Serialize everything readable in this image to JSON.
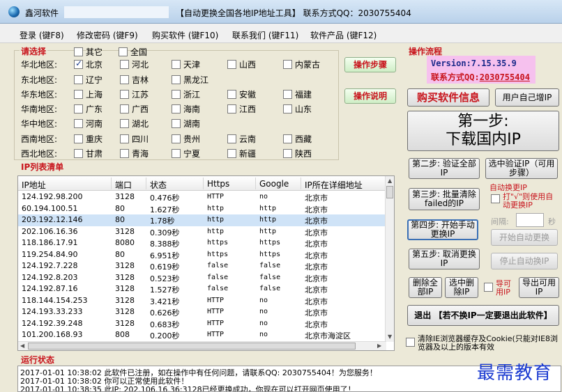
{
  "titlebar": {
    "app_name": "鑫河软件",
    "title": "【自动更换全国各地IP地址工具】 联系方式QQ：2030755404"
  },
  "menu": [
    "登录 (键F8)",
    "修改密码 (键F9)",
    "购买软件 (键F10)",
    "联系我们 (键F11)",
    "软件产品 (键F12)"
  ],
  "region_select": {
    "title": "请选择",
    "top_options": [
      {
        "label": "其它",
        "checked": false
      },
      {
        "label": "全国",
        "checked": false
      }
    ],
    "rows": [
      {
        "label": "华北地区:",
        "items": [
          {
            "label": "北京",
            "checked": true
          },
          {
            "label": "河北",
            "checked": false
          },
          {
            "label": "天津",
            "checked": false
          },
          {
            "label": "山西",
            "checked": false
          },
          {
            "label": "内蒙古",
            "checked": false
          }
        ]
      },
      {
        "label": "东北地区:",
        "items": [
          {
            "label": "辽宁",
            "checked": false
          },
          {
            "label": "吉林",
            "checked": false
          },
          {
            "label": "黑龙江",
            "checked": false
          }
        ]
      },
      {
        "label": "华东地区:",
        "items": [
          {
            "label": "上海",
            "checked": false
          },
          {
            "label": "江苏",
            "checked": false
          },
          {
            "label": "浙江",
            "checked": false
          },
          {
            "label": "安徽",
            "checked": false
          },
          {
            "label": "福建",
            "checked": false
          }
        ]
      },
      {
        "label": "华南地区:",
        "items": [
          {
            "label": "广东",
            "checked": false
          },
          {
            "label": "广西",
            "checked": false
          },
          {
            "label": "海南",
            "checked": false
          },
          {
            "label": "江西",
            "checked": false
          },
          {
            "label": "山东",
            "checked": false
          }
        ]
      },
      {
        "label": "华中地区:",
        "items": [
          {
            "label": "河南",
            "checked": false
          },
          {
            "label": "湖北",
            "checked": false
          },
          {
            "label": "湖南",
            "checked": false
          }
        ]
      },
      {
        "label": "西南地区:",
        "items": [
          {
            "label": "重庆",
            "checked": false
          },
          {
            "label": "四川",
            "checked": false
          },
          {
            "label": "贵州",
            "checked": false
          },
          {
            "label": "云南",
            "checked": false
          },
          {
            "label": "西藏",
            "checked": false
          }
        ]
      },
      {
        "label": "西北地区:",
        "items": [
          {
            "label": "甘肃",
            "checked": false
          },
          {
            "label": "青海",
            "checked": false
          },
          {
            "label": "宁夏",
            "checked": false
          },
          {
            "label": "新疆",
            "checked": false
          },
          {
            "label": "陕西",
            "checked": false
          }
        ]
      }
    ],
    "steps_button": "操作步骤",
    "help_button": "操作说明"
  },
  "process": {
    "title": "操作流程",
    "version": "Version:7.15.35.9",
    "contact_label": "联系方式QQ:",
    "contact_qq": "2030755404",
    "buy_button": "购买软件信息",
    "add_ip_button": "用户自己增IP",
    "step1_line1": "第一步:",
    "step1_line2": "下载国内IP",
    "step2_button": "第二步: 验证全部IP",
    "verify_ip_button": "选中验证IP（可用步骤）",
    "auto_title": "自动换更IP",
    "step3_button": "第三步: 批量清除failed的IP",
    "auto_hint": "打\"√\"则使用自动更换IP",
    "interval_label": "间隔:",
    "interval_unit": "秒",
    "step4_button": "第四步: 开始手动更换IP",
    "start_auto_button": "开始自动更换",
    "step5_button": "第五步: 取消更换IP",
    "stop_auto_button": "停止自动换IP",
    "delete_all_button": "删除全部IP",
    "delete_selected_button": "选中删除IP",
    "exportable_label": "导可用IP",
    "export_button": "导出可用IP",
    "exit_button": "退出 【若不换IP一定要退出此软件】",
    "clear_cookie_label": "清除IE浏览器缓存及Cookie(只能对IE8浏览器及以上的版本有效"
  },
  "ip_list": {
    "title": "IP列表清单",
    "columns": [
      "IP地址",
      "端口",
      "状态",
      "Https",
      "Google",
      "IP所在详细地址"
    ],
    "rows": [
      [
        "124.192.98.200",
        "3128",
        "0.476秒",
        "HTTP",
        "no",
        "北京市"
      ],
      [
        "60.194.100.51",
        "80",
        "1.627秒",
        "http",
        "http",
        "北京市"
      ],
      [
        "203.192.12.146",
        "80",
        "1.78秒",
        "http",
        "http",
        "北京市"
      ],
      [
        "202.106.16.36",
        "3128",
        "0.309秒",
        "http",
        "http",
        "北京市"
      ],
      [
        "118.186.17.91",
        "8080",
        "8.388秒",
        "https",
        "https",
        "北京市"
      ],
      [
        "119.254.84.90",
        "80",
        "6.951秒",
        "https",
        "https",
        "北京市"
      ],
      [
        "124.192.7.228",
        "3128",
        "0.619秒",
        "false",
        "false",
        "北京市"
      ],
      [
        "124.192.8.203",
        "3128",
        "0.523秒",
        "false",
        "false",
        "北京市"
      ],
      [
        "124.192.87.16",
        "3128",
        "1.527秒",
        "false",
        "false",
        "北京市"
      ],
      [
        "118.144.154.253",
        "3128",
        "3.421秒",
        "HTTP",
        "no",
        "北京市"
      ],
      [
        "124.193.33.233",
        "3128",
        "0.626秒",
        "HTTP",
        "no",
        "北京市"
      ],
      [
        "124.192.39.248",
        "3128",
        "0.683秒",
        "HTTP",
        "no",
        "北京市"
      ],
      [
        "101.200.168.93",
        "808",
        "0.200秒",
        "HTTP",
        "no",
        "北京市海淀区"
      ]
    ],
    "selected_row": 2
  },
  "status": {
    "title": "运行状态",
    "lines": [
      "2017-01-01 10:38:02 此软件已注册，如在操作中有任何问题，请联系QQ: 2030755404！为您服务！",
      "2017-01-01 10:38:02 你可以正常使用此软件！",
      "2017-01-01 10:38:35 此IP: 202.106.16.36:3128已经更换成功，你现在可以打开网页使用了！"
    ]
  },
  "watermark": "最需教育",
  "colors": {
    "accent_red": "#c8141c",
    "selected_row": "#cfe3f7",
    "version_box": "#f6c1ee"
  }
}
